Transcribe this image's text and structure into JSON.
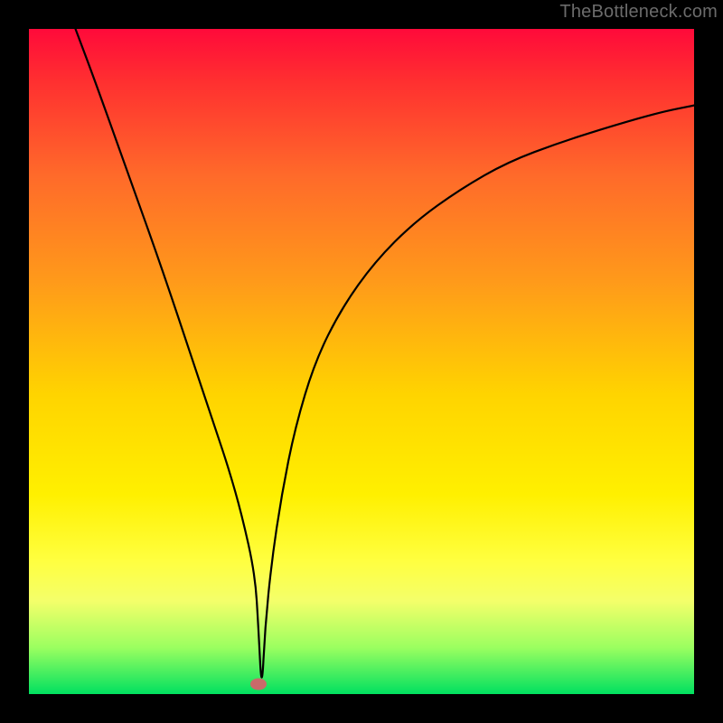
{
  "watermark": "TheBottleneck.com",
  "chart_data": {
    "type": "line",
    "title": "",
    "xlabel": "",
    "ylabel": "",
    "xlim": [
      0,
      100
    ],
    "ylim": [
      0,
      100
    ],
    "series": [
      {
        "name": "bottleneck-curve",
        "x": [
          7,
          10,
          15,
          20,
          25,
          28,
          30,
          32,
          34,
          34.5,
          35,
          35.5,
          36.5,
          38,
          40,
          43,
          47,
          52,
          58,
          65,
          72,
          80,
          88,
          95,
          100
        ],
        "y": [
          100,
          92,
          78,
          64,
          49,
          40,
          34,
          27,
          18,
          10,
          0,
          10,
          20,
          30,
          40,
          50,
          58,
          65,
          71,
          76,
          80,
          83,
          85.5,
          87.5,
          88.5
        ]
      }
    ],
    "marker": {
      "x": 34.5,
      "y": 1.5,
      "color": "#c96a6a"
    },
    "background_gradient": [
      "#ff0a3a",
      "#ffd400",
      "#00e060"
    ],
    "grid": false,
    "legend": false
  }
}
